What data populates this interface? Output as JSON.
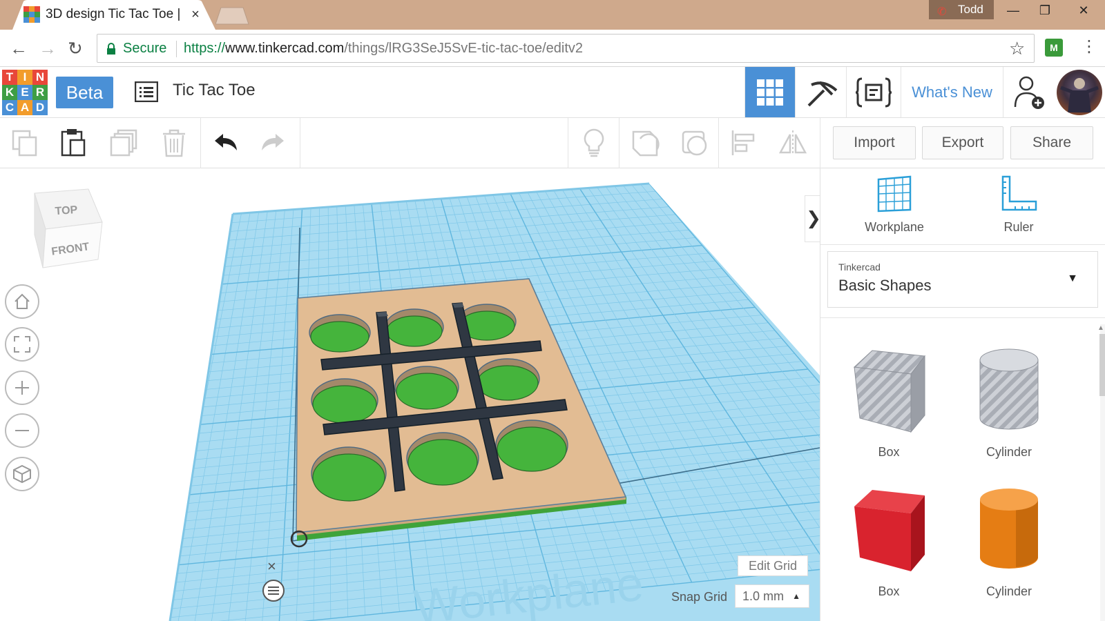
{
  "browser": {
    "tab_title": "3D design Tic Tac Toe | T",
    "tab_close": "×",
    "profile_name": "Todd",
    "window_controls": {
      "minimize": "—",
      "restore": "❐",
      "close": "✕"
    },
    "address": {
      "secure_label": "Secure",
      "url_protocol": "https://",
      "url_host": "www.tinkercad.com",
      "url_path": "/things/lRG3SeJ5SvE-tic-tac-toe/editv2"
    }
  },
  "app": {
    "logo_letters": [
      "T",
      "I",
      "N",
      "K",
      "E",
      "R",
      "C",
      "A",
      "D"
    ],
    "logo_colors": [
      "#e8473a",
      "#f29c2b",
      "#e8473a",
      "#3e9e44",
      "#4a90d6",
      "#3e9e44",
      "#4a90d6",
      "#f29c2b",
      "#4a90d6"
    ],
    "beta_label": "Beta",
    "design_title": "Tic Tac Toe",
    "whats_new": "What's New",
    "accent": "#4a90d6"
  },
  "toolbar": {
    "icons": [
      "copy-icon",
      "paste-icon",
      "duplicate-icon",
      "delete-icon",
      "undo-icon",
      "redo-icon",
      "note-icon",
      "solid-icon",
      "hole-icon",
      "align-icon",
      "mirror-icon"
    ],
    "import_label": "Import",
    "export_label": "Export",
    "share_label": "Share"
  },
  "viewport": {
    "viewcube_top": "TOP",
    "viewcube_front": "FRONT",
    "edit_grid": "Edit Grid",
    "snap_grid_label": "Snap Grid",
    "snap_grid_value": "1.0 mm",
    "workplane_watermark": "Workplane",
    "close_glyph": "×",
    "collapse_glyph": "❯"
  },
  "sidebar": {
    "workplane_label": "Workplane",
    "ruler_label": "Ruler",
    "library_category": "Tinkercad",
    "library_name": "Basic Shapes",
    "shapes": [
      {
        "label": "Box",
        "color": "#b8bcc4"
      },
      {
        "label": "Cylinder",
        "color": "#b8bcc4"
      },
      {
        "label": "Box",
        "color": "#d9232e"
      },
      {
        "label": "Cylinder",
        "color": "#f08a1c"
      }
    ]
  }
}
